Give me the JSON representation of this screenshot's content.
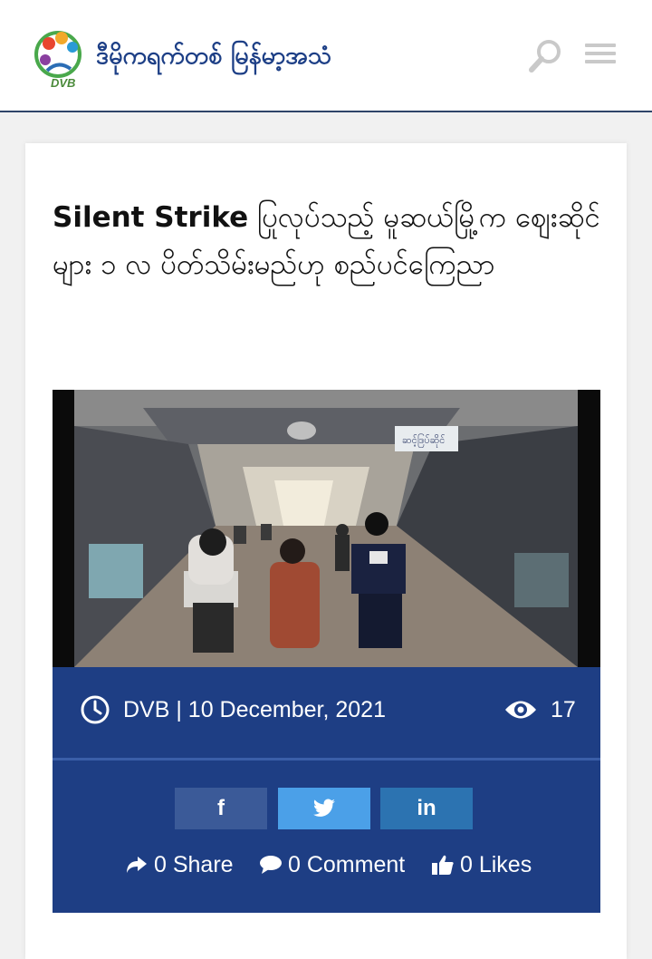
{
  "header": {
    "logo_text": "ဒီမိုကရက်တစ် မြန်မာ့အသံ",
    "logo_abbr": "DVB",
    "search_icon": "search-icon",
    "menu_icon": "hamburger-menu-icon"
  },
  "article": {
    "title_lead": "Silent Strike",
    "title_rest": " ပြုလုပ်သည့် မူဆယ်မြို့က ဈေးဆိုင်များ ၁ လ ပိတ်သိမ်းမည်ဟု စည်ပင်ကြေညာ",
    "image_sign": "ဆင့်ဒြပ်ဆိုင်",
    "byline": "DVB | 10 December, 2021",
    "views": "17",
    "clock_icon": "clock-icon",
    "eye_icon": "eye-icon"
  },
  "share": {
    "facebook_label": "f",
    "twitter_icon": "twitter-bird-icon",
    "linkedin_label": "in",
    "share_count": "0 Share",
    "comment_count": "0 Comment",
    "likes_count": "0 Likes"
  },
  "colors": {
    "brand_blue": "#1e3e84",
    "facebook": "#3b5a98",
    "twitter": "#4ba0e8",
    "linkedin": "#2c73b1",
    "header_rule": "#2f4569"
  }
}
